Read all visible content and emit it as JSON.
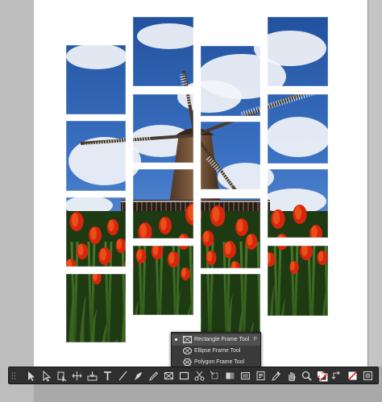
{
  "document": {
    "image_subject": "windmill-and-tulips-photo",
    "columns": 4
  },
  "tool_flyout": {
    "items": [
      {
        "label": "Rectangle Frame Tool",
        "shortcut": "F",
        "selected": true,
        "icon": "rectangle-frame-icon"
      },
      {
        "label": "Ellipse Frame Tool",
        "shortcut": "",
        "selected": false,
        "icon": "ellipse-frame-icon"
      },
      {
        "label": "Polygon Frame Tool",
        "shortcut": "",
        "selected": false,
        "icon": "polygon-frame-icon"
      }
    ]
  },
  "toolbar": {
    "tools": [
      "selection-tool-icon",
      "direct-selection-tool-icon",
      "page-tool-icon",
      "gap-tool-icon",
      "content-collector-icon",
      "type-tool-icon",
      "line-tool-icon",
      "pen-tool-icon",
      "pencil-tool-icon",
      "rectangle-frame-tool-icon",
      "rectangle-tool-icon",
      "scissors-tool-icon",
      "free-transform-tool-icon",
      "gradient-swatch-tool-icon",
      "gradient-feather-tool-icon",
      "note-tool-icon",
      "eyedropper-tool-icon",
      "hand-tool-icon",
      "zoom-tool-icon",
      "fill-stroke-icon",
      "swap-fill-stroke-icon",
      "apply-none-icon",
      "view-mode-icon"
    ]
  },
  "colors": {
    "pasteboard": "#a9a9a9",
    "page": "#ffffff",
    "toolbar": "#2f2f2f",
    "flyout": "#3a3a3a"
  }
}
